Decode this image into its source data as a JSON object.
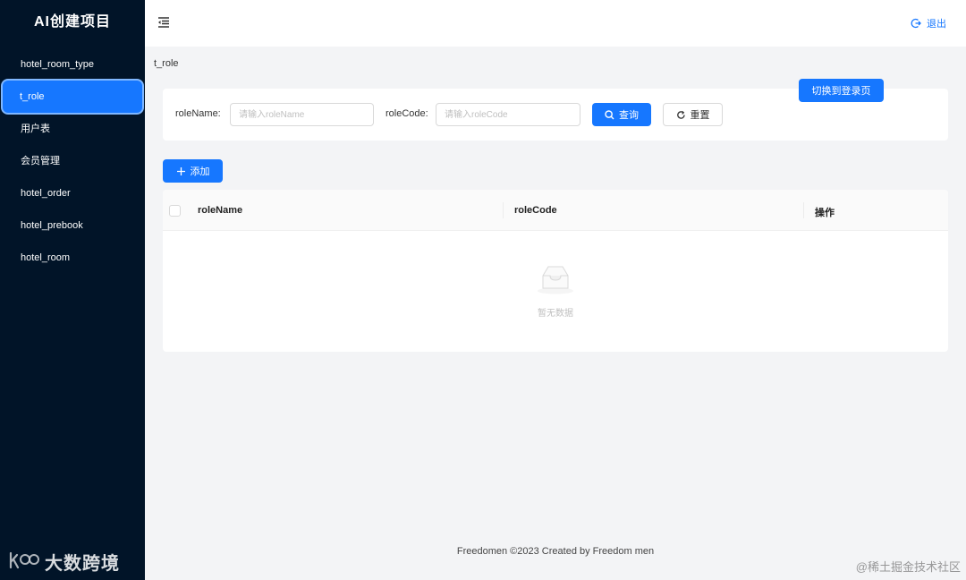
{
  "sidebar": {
    "brand": "AI创建项目",
    "items": [
      {
        "label": "hotel_room_type",
        "active": false
      },
      {
        "label": "t_role",
        "active": true
      },
      {
        "label": "用户表",
        "active": false
      },
      {
        "label": "会员管理",
        "active": false
      },
      {
        "label": "hotel_order",
        "active": false
      },
      {
        "label": "hotel_prebook",
        "active": false
      },
      {
        "label": "hotel_room",
        "active": false
      }
    ],
    "watermark": "大数跨境"
  },
  "header": {
    "menu_toggle_icon": "menu-fold-icon",
    "logout_label": "退出",
    "logout_icon": "logout-icon"
  },
  "breadcrumb": "t_role",
  "switch_button_label": "切换到登录页",
  "search": {
    "role_name_label": "roleName:",
    "role_name_placeholder": "请输入roleName",
    "role_name_value": "",
    "role_code_label": "roleCode:",
    "role_code_placeholder": "请输入roleCode",
    "role_code_value": "",
    "query_label": "查询",
    "reset_label": "重置"
  },
  "add_button_label": "添加",
  "table": {
    "columns": [
      "roleName",
      "roleCode",
      "操作"
    ],
    "rows": [],
    "empty_text": "暂无数据"
  },
  "footer": "Freedomen ©2023 Created by Freedom men",
  "watermark_right": "@稀土掘金技术社区",
  "colors": {
    "sidebar_bg": "#011428",
    "primary": "#1677ff",
    "page_bg": "#f3f4f6"
  }
}
